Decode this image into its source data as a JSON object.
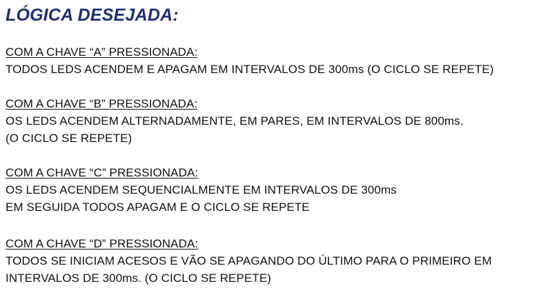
{
  "title": "LÓGICA DESEJADA:",
  "sections": [
    {
      "heading": "COM A CHAVE “A” PRESSIONADA:",
      "lines": [
        "TODOS LEDS ACENDEM E APAGAM EM INTERVALOS DE 300ms (O CICLO SE REPETE)"
      ]
    },
    {
      "heading": "COM A CHAVE “B” PRESSIONADA:",
      "lines": [
        "OS LEDS ACENDEM ALTERNADAMENTE, EM PARES, EM INTERVALOS DE 800ms.",
        "(O CICLO SE REPETE)"
      ]
    },
    {
      "heading": "COM A CHAVE “C” PRESSIONADA:",
      "lines": [
        "OS LEDS ACENDEM SEQUENCIALMENTE EM INTERVALOS DE 300ms",
        "EM SEGUIDA TODOS APAGAM E O CICLO SE REPETE"
      ]
    },
    {
      "heading": "COM A CHAVE “D” PRESSIONADA:",
      "lines": [
        "TODOS SE INICIAM ACESOS E VÃO SE APAGANDO DO ÚLTIMO PARA O PRIMEIRO EM",
        "INTERVALOS DE 300ms. (O CICLO SE REPETE)"
      ]
    }
  ],
  "colors": {
    "title": "#1f2f6e",
    "text": "#111111",
    "background": "#ffffff"
  }
}
